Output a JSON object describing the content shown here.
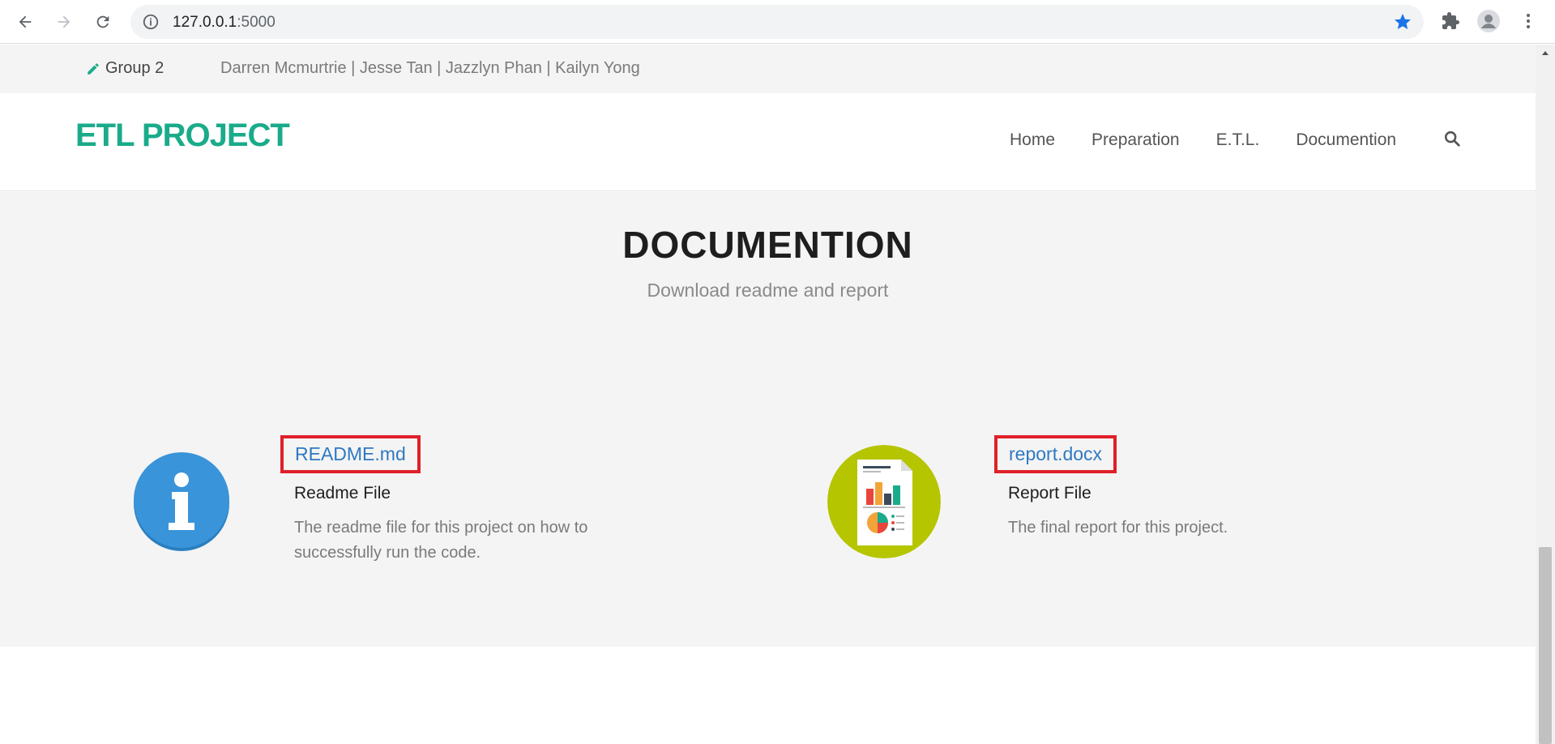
{
  "browser": {
    "url_host": "127.0.0.1",
    "url_port": ":5000"
  },
  "topbar": {
    "group_label": "Group 2",
    "members": "Darren Mcmurtrie | Jesse Tan | Jazzlyn Phan | Kailyn Yong"
  },
  "header": {
    "logo": "ETL PROJECT",
    "nav": [
      "Home",
      "Preparation",
      "E.T.L.",
      "Documention"
    ]
  },
  "section": {
    "title": "DOCUMENTION",
    "subtitle": "Download readme and report"
  },
  "documents": [
    {
      "link": "README.md",
      "name": "Readme File",
      "description_line1": "The readme file for this project on how to",
      "description_line2": "successfully run the code.",
      "icon": "info-icon"
    },
    {
      "link": "report.docx",
      "name": "Report File",
      "description_line1": "The final report for this project.",
      "description_line2": "",
      "icon": "report-icon"
    }
  ],
  "colors": {
    "brand": "#1aab8a",
    "link": "#2f79c1",
    "highlight": "#e0202a",
    "info_icon": "#3a94d9",
    "report_icon": "#b5c500"
  }
}
